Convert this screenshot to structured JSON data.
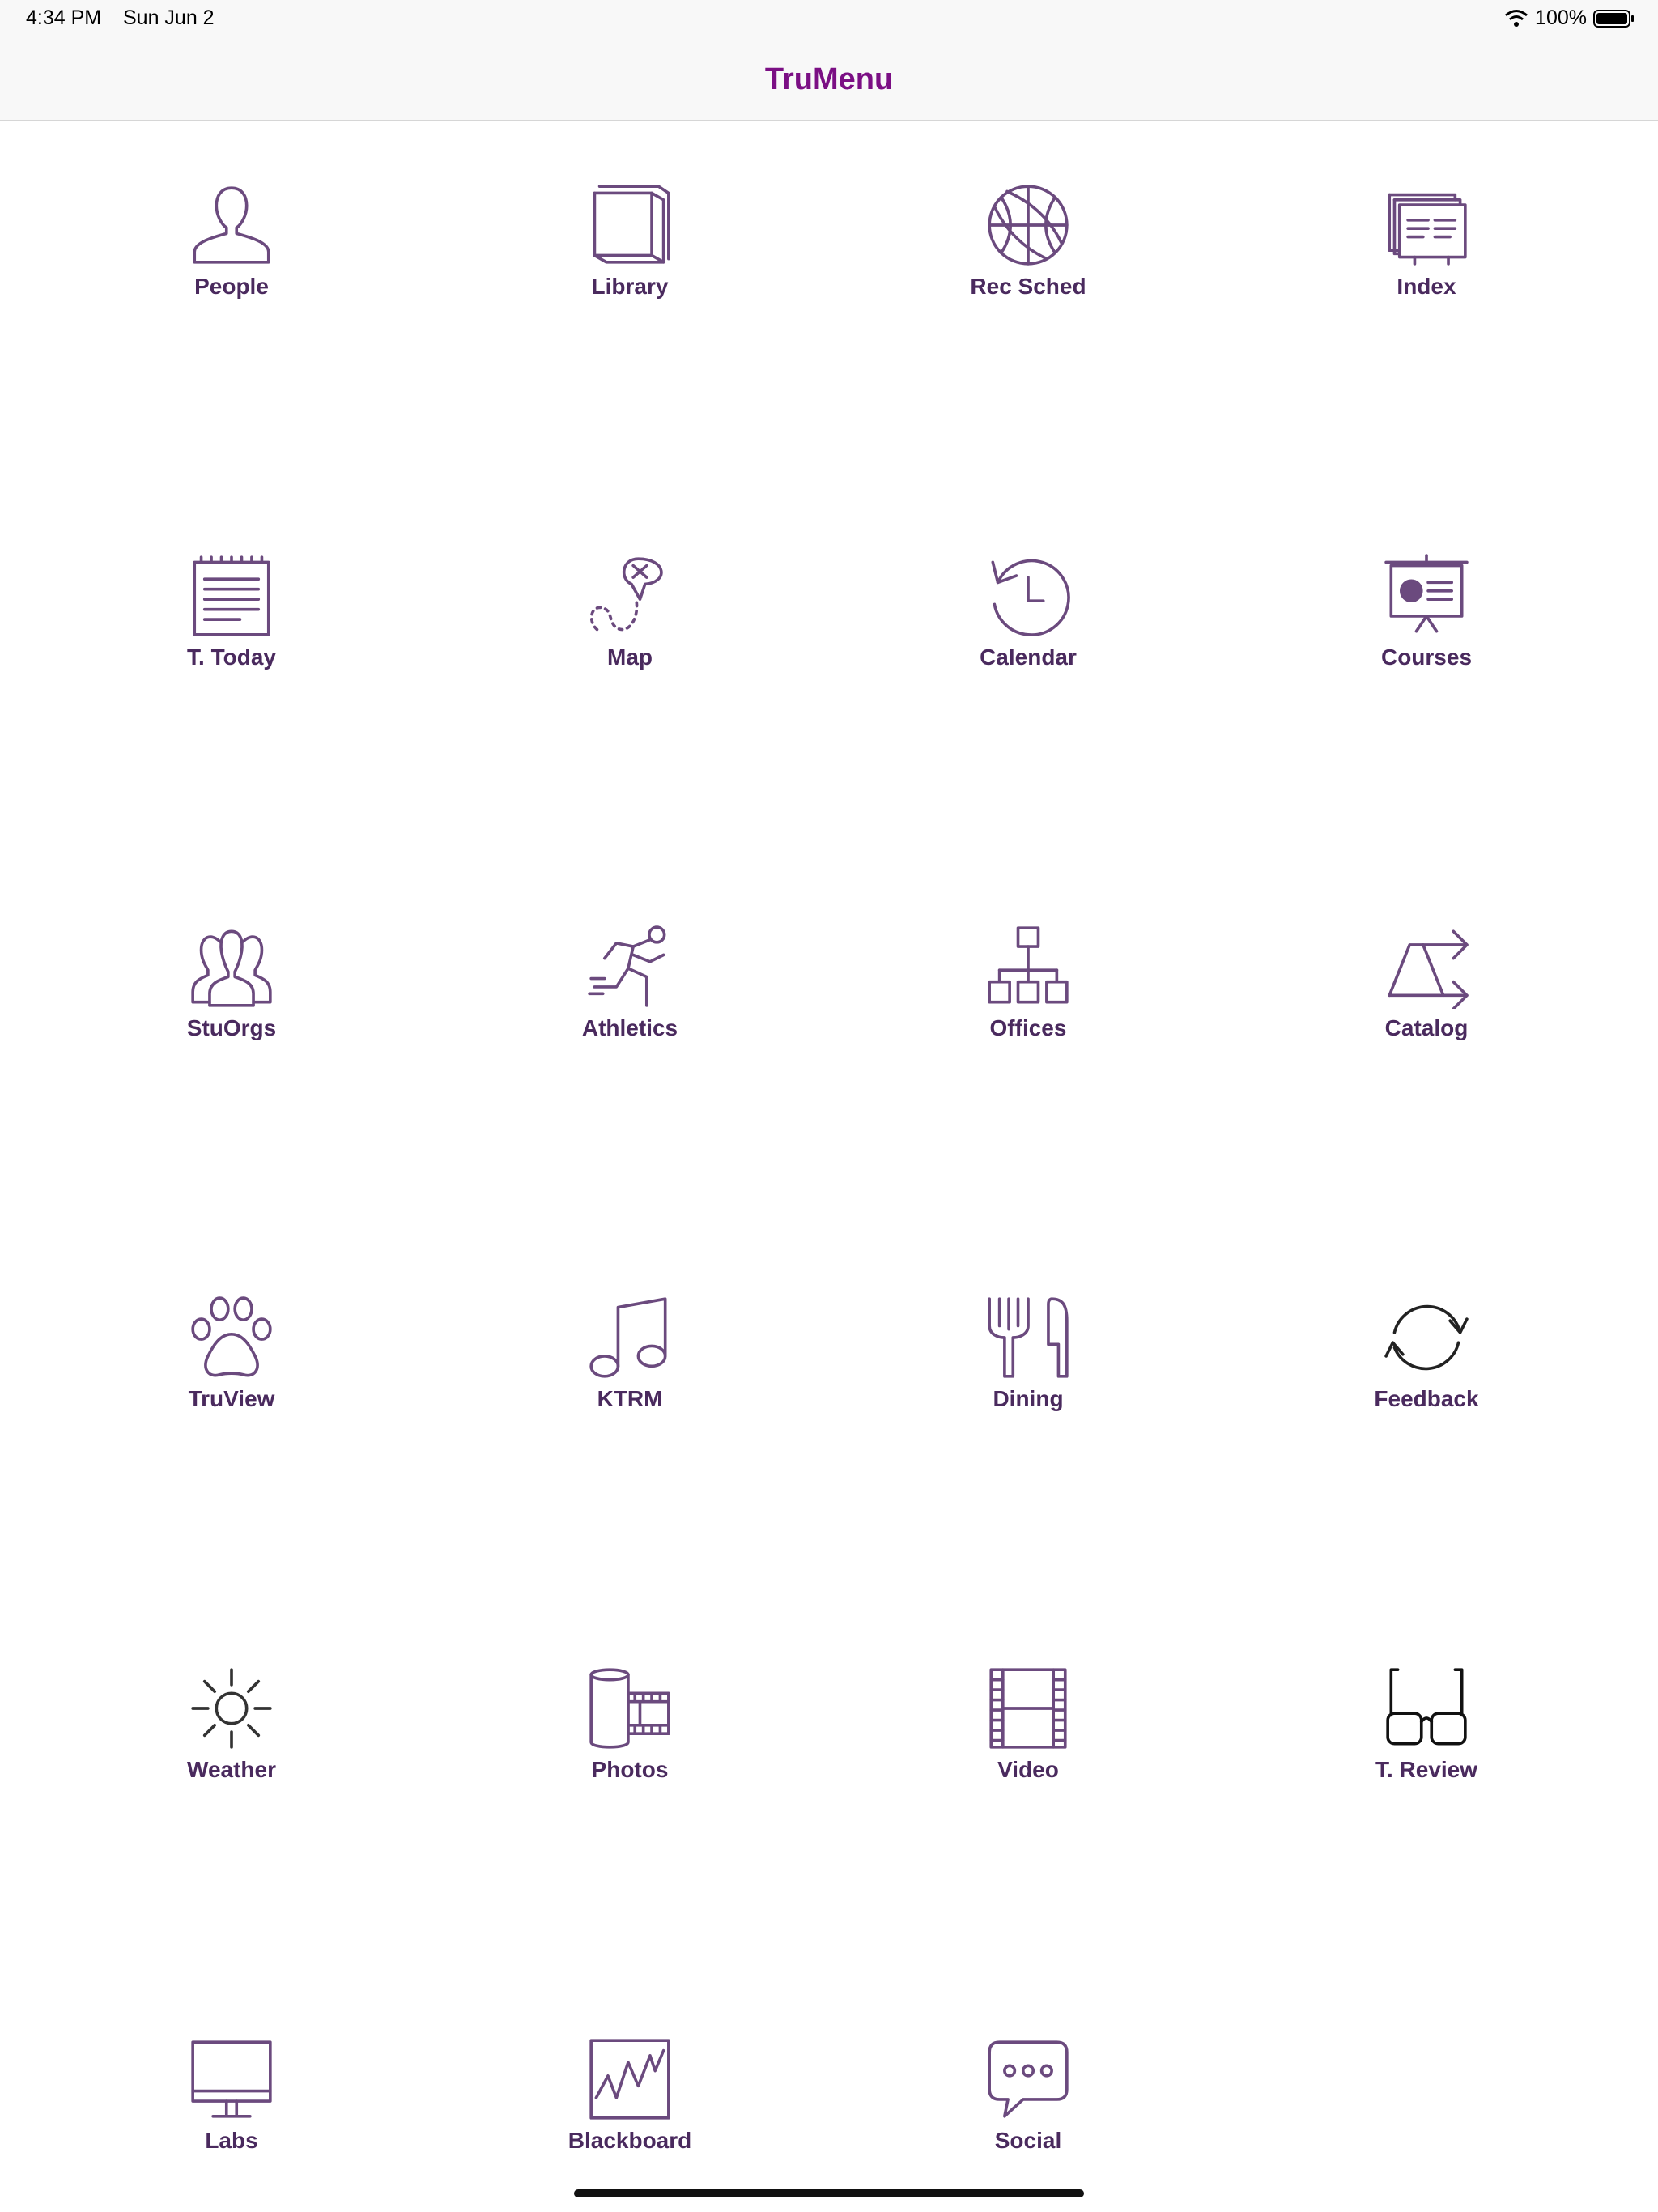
{
  "status_bar": {
    "time": "4:34 PM",
    "date": "Sun Jun 2",
    "battery_percent": "100%",
    "wifi_icon": "wifi-icon",
    "battery_icon": "battery-icon"
  },
  "nav": {
    "title": "TruMenu"
  },
  "colors": {
    "title": "#7b0f84",
    "icon_stroke": "#6b4a7e",
    "label": "#4a2a5e"
  },
  "tiles": [
    {
      "label": "People",
      "icon": "person-icon"
    },
    {
      "label": "Library",
      "icon": "books-icon"
    },
    {
      "label": "Rec Sched",
      "icon": "basketball-icon"
    },
    {
      "label": "Index",
      "icon": "index-cards-icon"
    },
    {
      "label": "T. Today",
      "icon": "notepad-icon"
    },
    {
      "label": "Map",
      "icon": "map-route-icon"
    },
    {
      "label": "Calendar",
      "icon": "history-clock-icon"
    },
    {
      "label": "Courses",
      "icon": "presentation-board-icon"
    },
    {
      "label": "StuOrgs",
      "icon": "group-icon"
    },
    {
      "label": "Athletics",
      "icon": "runner-icon"
    },
    {
      "label": "Offices",
      "icon": "org-chart-icon"
    },
    {
      "label": "Catalog",
      "icon": "arrows-icon"
    },
    {
      "label": "TruView",
      "icon": "paw-icon"
    },
    {
      "label": "KTRM",
      "icon": "music-note-icon"
    },
    {
      "label": "Dining",
      "icon": "fork-knife-icon"
    },
    {
      "label": "Feedback",
      "icon": "cycle-arrows-icon"
    },
    {
      "label": "Weather",
      "icon": "sun-icon"
    },
    {
      "label": "Photos",
      "icon": "film-roll-icon"
    },
    {
      "label": "Video",
      "icon": "film-strip-icon"
    },
    {
      "label": "T. Review",
      "icon": "glasses-icon"
    },
    {
      "label": "Labs",
      "icon": "monitor-icon"
    },
    {
      "label": "Blackboard",
      "icon": "chart-board-icon"
    },
    {
      "label": "Social",
      "icon": "chat-bubble-icon"
    }
  ]
}
